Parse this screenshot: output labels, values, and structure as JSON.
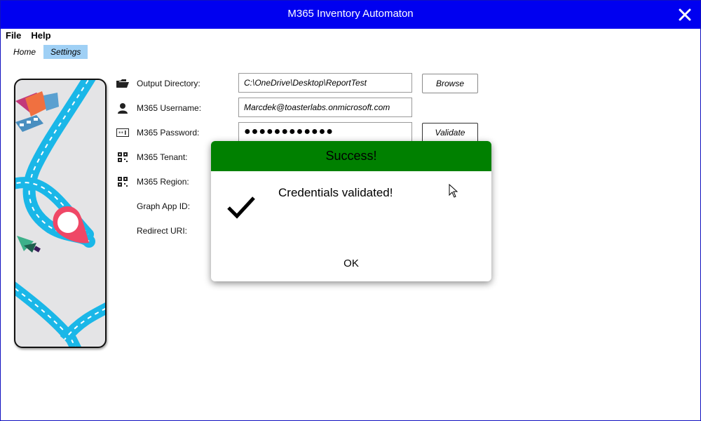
{
  "window": {
    "title": "M365 Inventory Automaton"
  },
  "menu": {
    "file": "File",
    "help": "Help"
  },
  "tabs": [
    {
      "label": "Home",
      "active": false
    },
    {
      "label": "Settings",
      "active": true
    }
  ],
  "form": {
    "output_directory": {
      "label": "Output Directory:",
      "value": "C:\\OneDrive\\Desktop\\ReportTest",
      "icon": "folder-icon"
    },
    "username": {
      "label": "M365 Username:",
      "value": "Marcdek@toasterlabs.onmicrosoft.com",
      "icon": "user-icon"
    },
    "password": {
      "label": "M365 Password:",
      "value": "●●●●●●●●●●●●",
      "icon": "password-icon"
    },
    "tenant": {
      "label": "M365 Tenant:",
      "icon": "qr-code-icon"
    },
    "region": {
      "label": "M365 Region:",
      "icon": "qr-code-icon"
    },
    "graph_app_id": {
      "label": "Graph App ID:"
    },
    "redirect_uri": {
      "label": "Redirect URI:"
    },
    "browse_label": "Browse",
    "validate_label": "Validate"
  },
  "dialog": {
    "title": "Success!",
    "message": "Credentials validated!",
    "ok_label": "OK",
    "icon": "checkmark-icon"
  },
  "colors": {
    "titlebar": "#0000f0",
    "dialog_header": "#008000",
    "active_tab": "#9fd0f5",
    "road": "#1ab7e8",
    "pin": "#ef4766"
  }
}
